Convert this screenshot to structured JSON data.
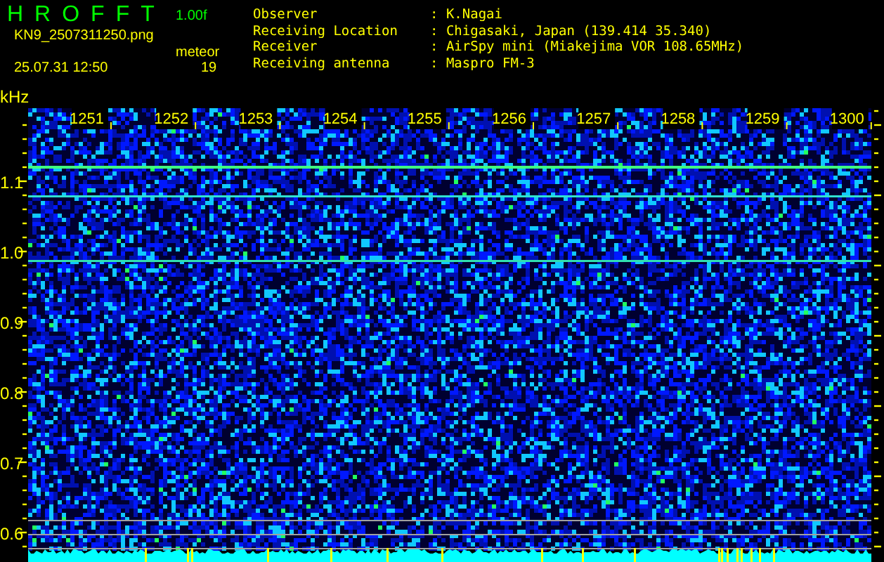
{
  "header": {
    "title": "HROFFT",
    "version": "1.00f",
    "filename": "KN9_2507311250.png",
    "detection": "meteor",
    "count": "19",
    "datetime": "25.07.31 12:50"
  },
  "info": [
    {
      "label": "Observer",
      "value": ": K.Nagai"
    },
    {
      "label": "Receiving Location",
      "value": ": Chigasaki, Japan (139.414 35.340)"
    },
    {
      "label": "Receiver",
      "value": ": AirSpy mini (Miakejima VOR 108.65MHz)"
    },
    {
      "label": "Receiving antenna",
      "value": ": Maspro FM-3"
    }
  ],
  "spectrogram": {
    "unit": "kHz",
    "frequency_labels": [
      "1.1",
      "1.0",
      "0.9",
      "0.8",
      "0.7",
      "0.6"
    ],
    "time_labels": [
      "1251",
      "1252",
      "1253",
      "1254",
      "1255",
      "1256",
      "1257",
      "1258",
      "1259",
      "1300"
    ]
  }
}
